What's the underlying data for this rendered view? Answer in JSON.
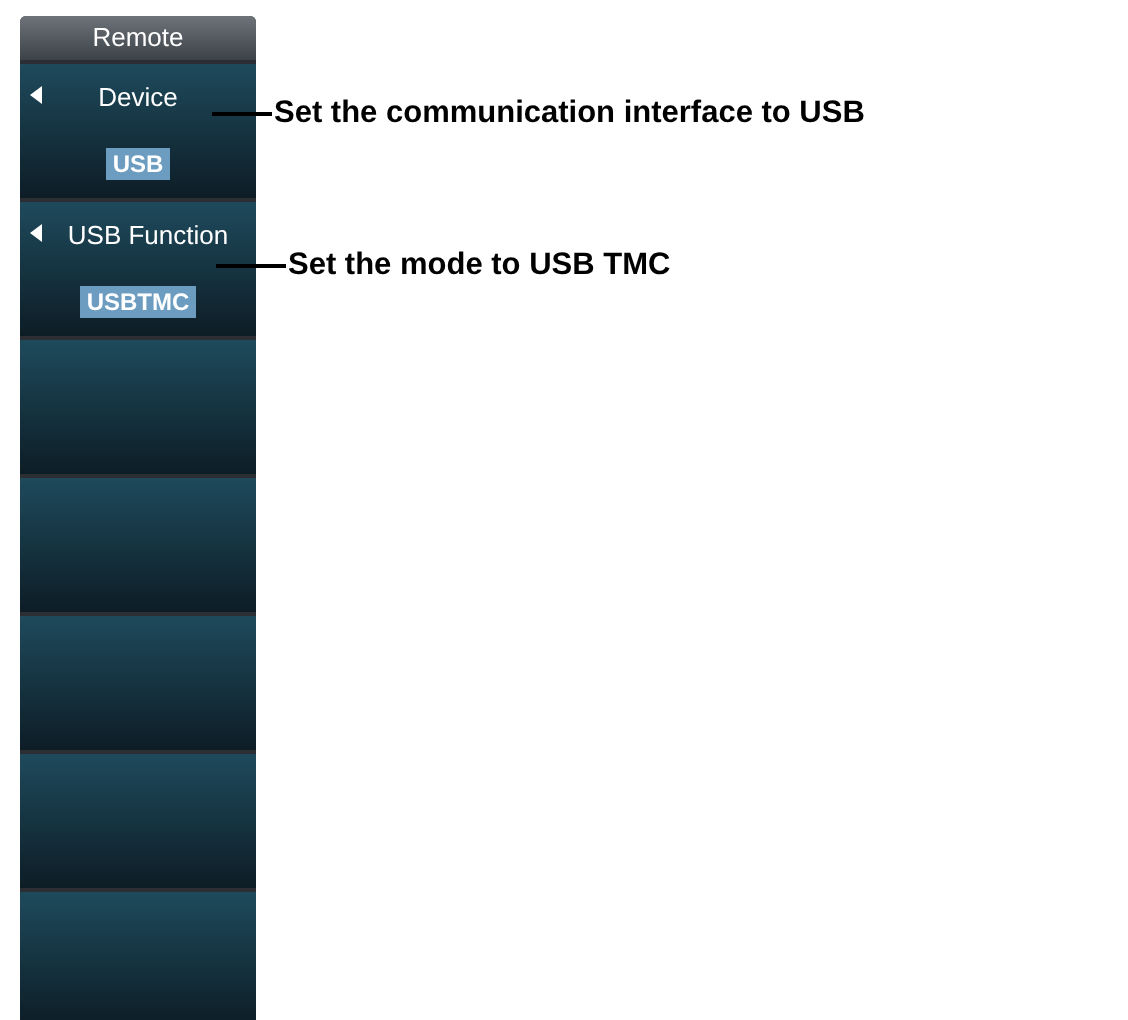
{
  "menu": {
    "title": "Remote",
    "softkeys": [
      {
        "kind": "select",
        "label": "Device",
        "value": "USB"
      },
      {
        "kind": "select",
        "label": "USB Function",
        "value": "USBTMC"
      },
      {
        "kind": "blank"
      },
      {
        "kind": "blank"
      },
      {
        "kind": "blank"
      },
      {
        "kind": "blank"
      },
      {
        "kind": "blank"
      }
    ]
  },
  "callouts": [
    {
      "text": "Set the communication interface to USB"
    },
    {
      "text": "Set the mode to USB TMC"
    }
  ]
}
